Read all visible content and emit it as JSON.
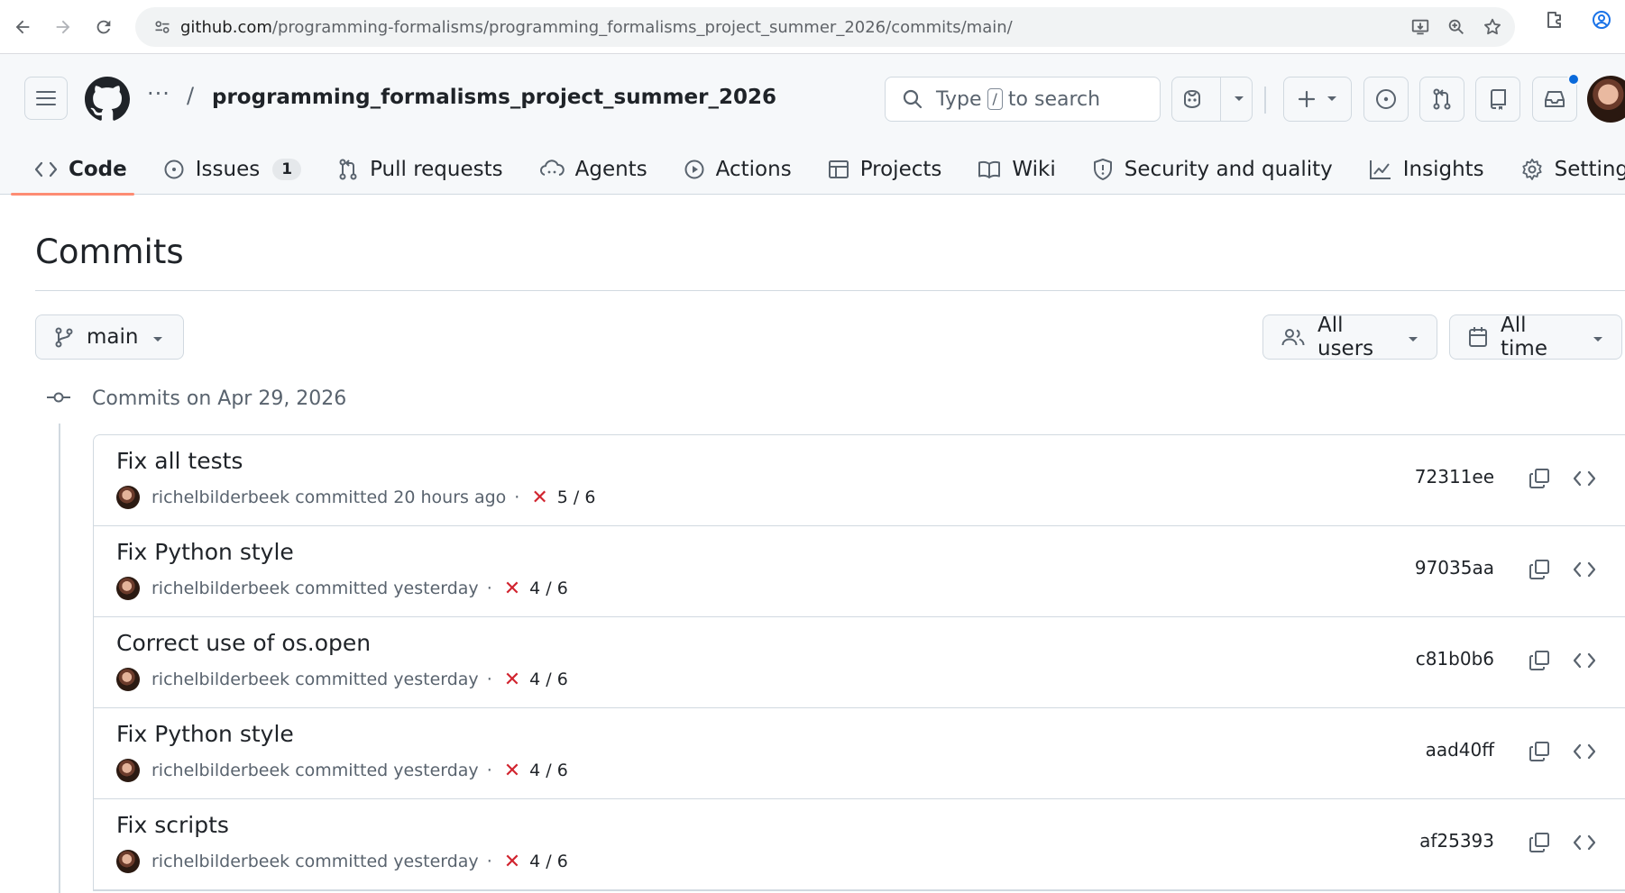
{
  "browser": {
    "url_host": "github.com",
    "url_path": "/programming-formalisms/programming_formalisms_project_summer_2026/commits/main/"
  },
  "header": {
    "repo_name": "programming_formalisms_project_summer_2026",
    "search_type": "Type",
    "search_key": "/",
    "search_suffix": "to search"
  },
  "repo_nav": {
    "tabs": [
      {
        "label": "Code",
        "icon": "code-icon"
      },
      {
        "label": "Issues",
        "icon": "issue-icon",
        "counter": "1"
      },
      {
        "label": "Pull requests",
        "icon": "pull-request-icon"
      },
      {
        "label": "Agents",
        "icon": "agents-icon"
      },
      {
        "label": "Actions",
        "icon": "play-icon"
      },
      {
        "label": "Projects",
        "icon": "table-icon"
      },
      {
        "label": "Wiki",
        "icon": "book-icon"
      },
      {
        "label": "Security and quality",
        "icon": "shield-icon"
      },
      {
        "label": "Insights",
        "icon": "graph-icon"
      },
      {
        "label": "Settings",
        "icon": "gear-icon"
      }
    ]
  },
  "main": {
    "title": "Commits",
    "branch": "main",
    "users_filter": "All users",
    "time_filter": "All time",
    "day_heading": "Commits on Apr 29, 2026",
    "commits": [
      {
        "title": "Fix all tests",
        "author": "richelbilderbeek",
        "verb": "committed",
        "when": "20 hours ago",
        "checks": "5 / 6",
        "sha": "72311ee"
      },
      {
        "title": "Fix Python style",
        "author": "richelbilderbeek",
        "verb": "committed",
        "when": "yesterday",
        "checks": "4 / 6",
        "sha": "97035aa"
      },
      {
        "title": "Correct use of os.open",
        "author": "richelbilderbeek",
        "verb": "committed",
        "when": "yesterday",
        "checks": "4 / 6",
        "sha": "c81b0b6"
      },
      {
        "title": "Fix Python style",
        "author": "richelbilderbeek",
        "verb": "committed",
        "when": "yesterday",
        "checks": "4 / 6",
        "sha": "aad40ff"
      },
      {
        "title": "Fix scripts",
        "author": "richelbilderbeek",
        "verb": "committed",
        "when": "yesterday",
        "checks": "4 / 6",
        "sha": "af25393"
      }
    ]
  },
  "colors": {
    "active_tab_underline": "#fd8c73",
    "failure": "#d1242f",
    "notification": "#0969da"
  }
}
